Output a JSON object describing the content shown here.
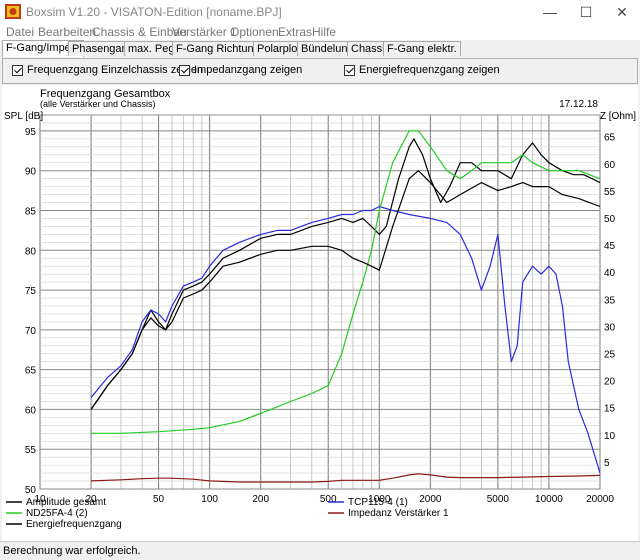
{
  "window": {
    "title": "Boxsim V1.20 - VISATON-Edition [noname.BPJ]",
    "minimize": "—",
    "maximize": "☐",
    "close": "✕"
  },
  "menu": [
    "Datei",
    "Bearbeiten",
    "Chassis & Einbau",
    "Verstärker 1",
    "Optionen",
    "Extras",
    "Hilfe"
  ],
  "tabs": [
    "F-Gang/Imped.",
    "Phasengang",
    "max. Pegel",
    "F-Gang Richtungen",
    "Polarplots",
    "Bündelung",
    "Chassis",
    "F-Gang elektr."
  ],
  "active_tab": "F-Gang/Imped.",
  "options": [
    {
      "label": "Frequenzgang Einzelchassis zeigen",
      "checked": true
    },
    {
      "label": "Impedanzgang zeigen",
      "checked": true
    },
    {
      "label": "Energiefrequenzgang zeigen",
      "checked": true
    }
  ],
  "chart": {
    "title": "Frequenzgang Gesamtbox",
    "subtitle": "(alle Verstärker und Chassis)",
    "date": "17.12.18",
    "left_axis_label": "SPL [dB]",
    "right_axis_label": "Z [Ohm]",
    "x_ticks": [
      "10",
      "20",
      "50",
      "100",
      "200",
      "500",
      "1000",
      "2000",
      "5000",
      "10000",
      "20000"
    ],
    "y_left_ticks": [
      "95",
      "90",
      "85",
      "80",
      "75",
      "70",
      "65",
      "60",
      "55",
      "50"
    ],
    "y_right_ticks": [
      "65",
      "60",
      "55",
      "50",
      "45",
      "40",
      "35",
      "30",
      "25",
      "20",
      "15",
      "10",
      "5"
    ],
    "legend": [
      {
        "label": "Amplitude gesamt",
        "color": "#000000"
      },
      {
        "label": "TCP115-4 (1)",
        "color": "#2a2ae0"
      },
      {
        "label": "ND25FA-4 (2)",
        "color": "#22cc22"
      },
      {
        "label": "Impedanz Verstärker 1",
        "color": "#8b1a1a"
      },
      {
        "label": "Energiefrequenzgang",
        "color": "#000000"
      }
    ]
  },
  "chart_data": {
    "type": "line",
    "title": "Frequenzgang Gesamtbox",
    "subtitle": "(alle Verstärker und Chassis)",
    "xlabel": "",
    "ylabel": "SPL [dB]",
    "y2label": "Z [Ohm]",
    "xscale": "log",
    "xlim": [
      10,
      20000
    ],
    "ylim": [
      50,
      97
    ],
    "y2lim": [
      0,
      69
    ],
    "grid": true,
    "series": [
      {
        "name": "Amplitude gesamt",
        "axis": "left",
        "color": "#000000",
        "x": [
          20,
          25,
          30,
          35,
          40,
          45,
          50,
          55,
          60,
          70,
          80,
          90,
          100,
          120,
          150,
          200,
          250,
          300,
          400,
          500,
          600,
          700,
          800,
          900,
          1000,
          1100,
          1300,
          1500,
          1600,
          1800,
          2000,
          2300,
          2600,
          3000,
          3500,
          4000,
          5000,
          6000,
          7000,
          8000,
          9000,
          10000,
          12000,
          14000,
          16000,
          18000,
          20000
        ],
        "y": [
          60,
          63,
          65,
          67,
          70,
          72.5,
          71,
          70,
          72,
          75,
          75.5,
          76,
          77,
          79,
          80,
          81.5,
          82,
          82,
          83,
          83.5,
          84,
          83.5,
          84,
          83,
          82,
          83,
          89,
          93,
          94,
          92,
          89,
          86,
          88,
          91,
          91,
          90,
          90,
          89,
          92,
          93.5,
          92,
          91,
          90,
          89.5,
          89.5,
          89,
          88.5
        ]
      },
      {
        "name": "TCP115-4 (1)",
        "axis": "left",
        "color": "#2a2ae0",
        "x": [
          20,
          25,
          30,
          35,
          40,
          45,
          50,
          55,
          60,
          70,
          80,
          90,
          100,
          120,
          150,
          200,
          250,
          300,
          400,
          500,
          600,
          700,
          800,
          900,
          1000,
          1200,
          1500,
          2000,
          2500,
          3000,
          3500,
          4000,
          4500,
          5000,
          5500,
          6000,
          6500,
          7000,
          8000,
          9000,
          10000,
          11000,
          12000,
          13000,
          15000,
          17000,
          20000
        ],
        "y": [
          61.5,
          64,
          65.5,
          67.5,
          71,
          72.5,
          72,
          71,
          73,
          75.5,
          76,
          76.5,
          78,
          80,
          81,
          82,
          82.5,
          82.5,
          83.5,
          84,
          84.5,
          84.5,
          85,
          85,
          85.5,
          85,
          84.5,
          84,
          83.5,
          82,
          79,
          75,
          78,
          82,
          73,
          66,
          68,
          76,
          78,
          77,
          78,
          77,
          73,
          66,
          60,
          57,
          52
        ]
      },
      {
        "name": "ND25FA-4 (2)",
        "axis": "left",
        "color": "#22cc22",
        "x": [
          20,
          30,
          50,
          80,
          100,
          150,
          200,
          300,
          400,
          500,
          600,
          700,
          800,
          900,
          1000,
          1200,
          1500,
          1700,
          2000,
          2500,
          3000,
          3500,
          4000,
          5000,
          6000,
          7000,
          8000,
          10000,
          12000,
          15000,
          20000
        ],
        "y": [
          57,
          57,
          57.2,
          57.5,
          57.7,
          58.5,
          59.5,
          61,
          62,
          63,
          67,
          72,
          76,
          80,
          85,
          91,
          95,
          95,
          93,
          90,
          89,
          90,
          91,
          91,
          91,
          92,
          91,
          90,
          90,
          90,
          89
        ]
      },
      {
        "name": "Impedanz Verstärker 1",
        "axis": "right",
        "color": "#8b1a1a",
        "x": [
          20,
          30,
          40,
          50,
          60,
          80,
          100,
          150,
          200,
          300,
          400,
          500,
          600,
          800,
          1000,
          1200,
          1500,
          1700,
          2000,
          2500,
          3000,
          4000,
          5000,
          7000,
          10000,
          15000,
          20000
        ],
        "y": [
          1.5,
          1.7,
          1.9,
          2.0,
          2.0,
          1.8,
          1.5,
          1.3,
          1.3,
          1.3,
          1.3,
          1.4,
          1.6,
          1.6,
          1.6,
          2.0,
          2.6,
          2.8,
          2.6,
          2.2,
          2.1,
          2.1,
          2.1,
          2.2,
          2.3,
          2.4,
          2.5
        ]
      },
      {
        "name": "Energiefrequenzgang",
        "axis": "left",
        "color": "#000000",
        "x": [
          20,
          25,
          30,
          35,
          40,
          45,
          50,
          55,
          60,
          70,
          80,
          90,
          100,
          120,
          150,
          200,
          250,
          300,
          400,
          500,
          600,
          700,
          800,
          900,
          1000,
          1200,
          1500,
          1700,
          2000,
          2500,
          3000,
          4000,
          5000,
          6000,
          7000,
          8000,
          10000,
          12000,
          15000,
          20000
        ],
        "y": [
          60,
          63,
          65,
          67,
          70,
          71.5,
          70.5,
          70,
          71,
          74,
          74.5,
          75,
          76,
          78,
          78.5,
          79.5,
          80,
          80,
          80.5,
          80.5,
          80,
          79,
          78.5,
          78,
          77.5,
          83,
          89,
          90,
          88.5,
          86,
          87,
          88.5,
          87.5,
          88,
          88.5,
          88,
          88,
          87,
          86.5,
          85.5
        ]
      }
    ]
  },
  "status": "Berechnung war erfolgreich."
}
